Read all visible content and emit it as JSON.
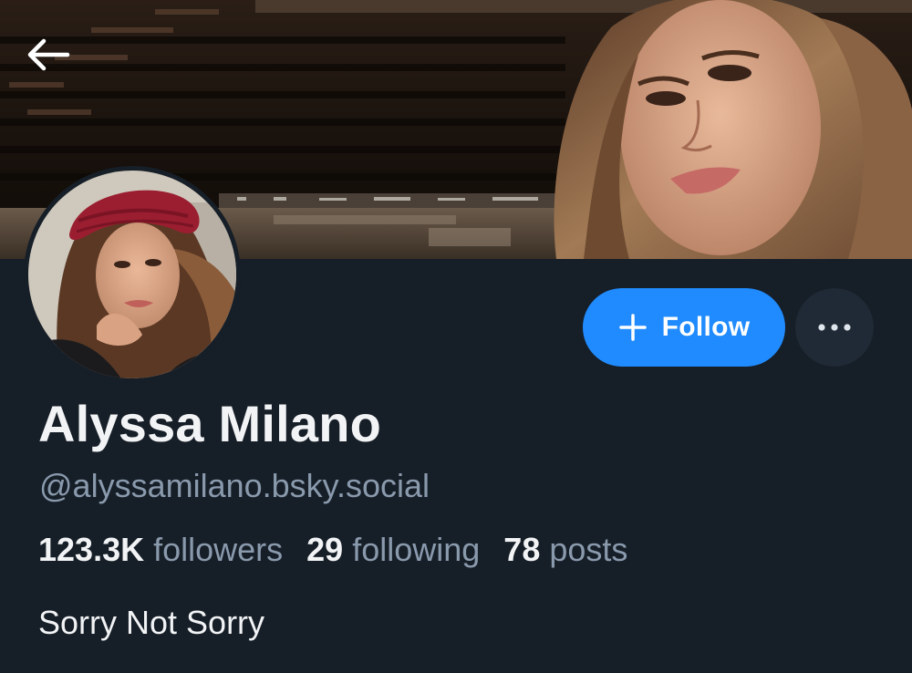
{
  "profile": {
    "display_name": "Alyssa Milano",
    "handle": "@alyssamilano.bsky.social",
    "bio": "Sorry Not Sorry"
  },
  "stats": {
    "followers_count": "123.3K",
    "followers_label": "followers",
    "following_count": "29",
    "following_label": "following",
    "posts_count": "78",
    "posts_label": "posts"
  },
  "actions": {
    "follow_label": "Follow",
    "follow_icon": "plus-icon",
    "more_icon": "ellipsis-icon",
    "back_icon": "arrow-left-icon"
  },
  "colors": {
    "background": "#161e27",
    "accent": "#208bfe",
    "text_primary": "#f1f3f5",
    "text_secondary": "#8a9aad"
  }
}
